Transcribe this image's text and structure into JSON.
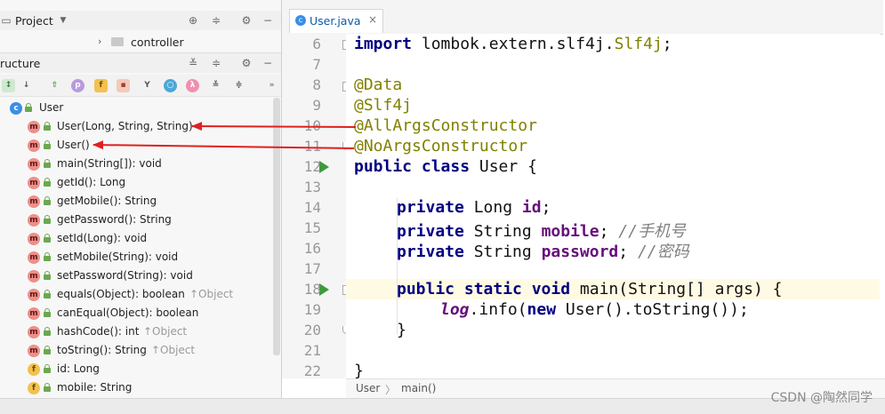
{
  "project_header": {
    "title": "Project"
  },
  "controller_item": {
    "label": "controller"
  },
  "structure_header": {
    "title": "ructure"
  },
  "tree": {
    "root": "User",
    "items": [
      {
        "label": "User(Long, String, String)",
        "suffix": "",
        "kind": "m"
      },
      {
        "label": "User()",
        "suffix": "",
        "kind": "m"
      },
      {
        "label": "main(String[]): void",
        "suffix": "",
        "kind": "m"
      },
      {
        "label": "getId(): Long",
        "suffix": "",
        "kind": "m"
      },
      {
        "label": "getMobile(): String",
        "suffix": "",
        "kind": "m"
      },
      {
        "label": "getPassword(): String",
        "suffix": "",
        "kind": "m"
      },
      {
        "label": "setId(Long): void",
        "suffix": "",
        "kind": "m"
      },
      {
        "label": "setMobile(String): void",
        "suffix": "",
        "kind": "m"
      },
      {
        "label": "setPassword(String): void",
        "suffix": "",
        "kind": "m"
      },
      {
        "label": "equals(Object): boolean",
        "suffix": "↑Object",
        "kind": "m"
      },
      {
        "label": "canEqual(Object): boolean",
        "suffix": "",
        "kind": "m"
      },
      {
        "label": "hashCode(): int",
        "suffix": "↑Object",
        "kind": "m"
      },
      {
        "label": "toString(): String",
        "suffix": "↑Object",
        "kind": "m"
      },
      {
        "label": "id: Long",
        "suffix": "",
        "kind": "f"
      },
      {
        "label": "mobile: String",
        "suffix": "",
        "kind": "f"
      }
    ]
  },
  "editor_tab": {
    "name": "User.java",
    "close": "×"
  },
  "gutter": {
    "line_numbers": [
      "6",
      "7",
      "8",
      "9",
      "10",
      "11",
      "12",
      "13",
      "14",
      "15",
      "16",
      "17",
      "18",
      "19",
      "20",
      "21",
      "22"
    ]
  },
  "code": {
    "import_kw": "import",
    "import_pkg": " lombok.extern.slf4j.",
    "import_cls": "Slf4j",
    "import_end": ";",
    "ann_data": "@Data",
    "ann_slf4j": "@Slf4j",
    "ann_all": "@AllArgsConstructor",
    "ann_no": "@NoArgsConstructor",
    "class_kw": "public class",
    "class_name": " User {",
    "priv": "private",
    "t_long": " Long ",
    "f_id": "id",
    "t_string": " String ",
    "f_mobile": "mobile",
    "f_password": "password",
    "semi": ";",
    "c_mobile": " //手机号",
    "c_password": " //密码",
    "main_kw": "public static void",
    "main_name": " main",
    "main_args": "(String[] args) {",
    "log": "log",
    "info": ".info(",
    "new_kw": "new",
    "new_rest": " User().toString());",
    "close_brace": "}",
    "close_class": "}"
  },
  "breadcrumb": {
    "class": "User",
    "sep": "〉",
    "method": "main()"
  },
  "watermark": "CSDN @陶然同学",
  "colors": {
    "annotation": "#808000",
    "keyword": "#000080",
    "arrow": "#e02020"
  }
}
